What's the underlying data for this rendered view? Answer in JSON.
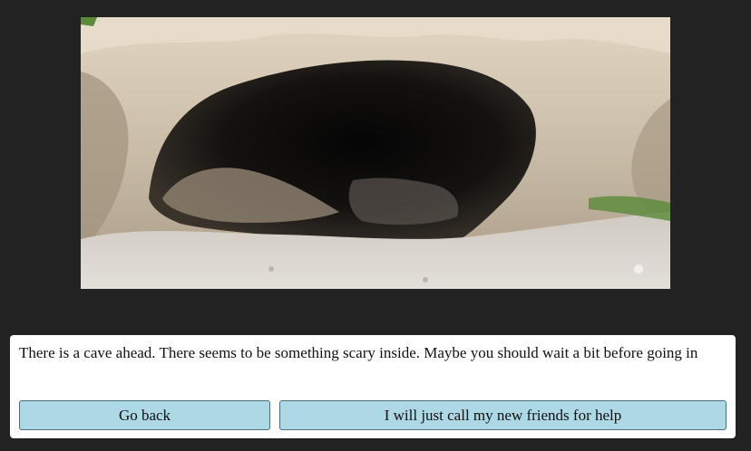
{
  "scene": {
    "image_subject": "cave-entrance",
    "colors": {
      "background": "#222222",
      "rock_light": "#d9cfc0",
      "rock_mid": "#b7a994",
      "cave_dark": "#0c0b0a",
      "ground": "#d7d2cb",
      "moss": "#5a8a3a"
    }
  },
  "dialog": {
    "text": "There is a cave ahead. There seems to be something scary inside. Maybe you should wait a bit before going in",
    "choices": [
      {
        "label": "Go back"
      },
      {
        "label": "I will just call my new friends for help"
      }
    ],
    "button_color": "#add8e6"
  }
}
